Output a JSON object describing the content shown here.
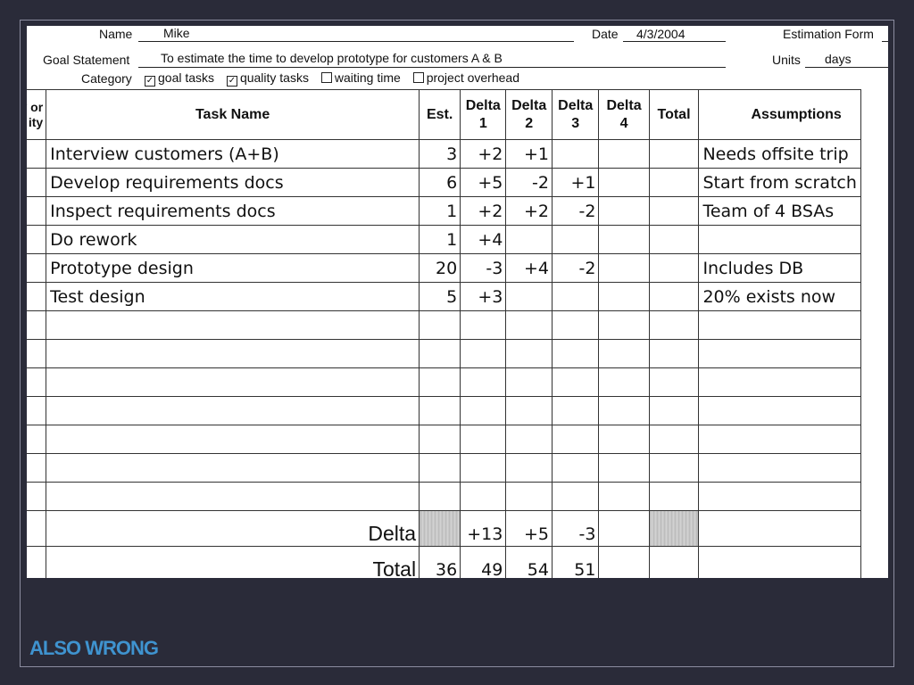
{
  "header": {
    "name_label": "Name",
    "name_value": "Mike",
    "date_label": "Date",
    "date_value": "4/3/2004",
    "form_title": "Estimation Form",
    "goal_label": "Goal Statement",
    "goal_value": "To estimate the time to develop prototype for customers A & B",
    "units_label": "Units",
    "units_value": "days",
    "category_label": "Category",
    "categories": [
      {
        "label": "goal tasks",
        "checked": true
      },
      {
        "label": "quality tasks",
        "checked": true
      },
      {
        "label": "waiting time",
        "checked": false
      },
      {
        "label": "project overhead",
        "checked": false
      }
    ]
  },
  "table": {
    "columns": {
      "cut_line1": "* or",
      "cut_line2": "ity",
      "task_name": "Task Name",
      "est": "Est.",
      "delta1_line1": "Delta",
      "delta1_line2": "1",
      "delta2_line1": "Delta",
      "delta2_line2": "2",
      "delta3_line1": "Delta",
      "delta3_line2": "3",
      "delta4_line1": "Delta",
      "delta4_line2": "4",
      "total": "Total",
      "assumptions": "Assumptions"
    },
    "rows": [
      {
        "task": "Interview customers (A+B)",
        "est": "3",
        "d1": "+2",
        "d2": "+1",
        "d3": "",
        "d4": "",
        "total": "",
        "assumption": "Needs offsite trip"
      },
      {
        "task": "Develop requirements docs",
        "est": "6",
        "d1": "+5",
        "d2": "-2",
        "d3": "+1",
        "d4": "",
        "total": "",
        "assumption": "Start from scratch"
      },
      {
        "task": "Inspect requirements docs",
        "est": "1",
        "d1": "+2",
        "d2": "+2",
        "d3": "-2",
        "d4": "",
        "total": "",
        "assumption": "Team of 4 BSAs"
      },
      {
        "task": "Do rework",
        "est": "1",
        "d1": "+4",
        "d2": "",
        "d3": "",
        "d4": "",
        "total": "",
        "assumption": ""
      },
      {
        "task": "Prototype design",
        "est": "20",
        "d1": "-3",
        "d2": "+4",
        "d3": "-2",
        "d4": "",
        "total": "",
        "assumption": "Includes DB"
      },
      {
        "task": "Test design",
        "est": "5",
        "d1": "+3",
        "d2": "",
        "d3": "",
        "d4": "",
        "total": "",
        "assumption": "20% exists now"
      },
      {
        "task": "",
        "est": "",
        "d1": "",
        "d2": "",
        "d3": "",
        "d4": "",
        "total": "",
        "assumption": ""
      },
      {
        "task": "",
        "est": "",
        "d1": "",
        "d2": "",
        "d3": "",
        "d4": "",
        "total": "",
        "assumption": ""
      },
      {
        "task": "",
        "est": "",
        "d1": "",
        "d2": "",
        "d3": "",
        "d4": "",
        "total": "",
        "assumption": ""
      },
      {
        "task": "",
        "est": "",
        "d1": "",
        "d2": "",
        "d3": "",
        "d4": "",
        "total": "",
        "assumption": ""
      },
      {
        "task": "",
        "est": "",
        "d1": "",
        "d2": "",
        "d3": "",
        "d4": "",
        "total": "",
        "assumption": ""
      },
      {
        "task": "",
        "est": "",
        "d1": "",
        "d2": "",
        "d3": "",
        "d4": "",
        "total": "",
        "assumption": ""
      },
      {
        "task": "",
        "est": "",
        "d1": "",
        "d2": "",
        "d3": "",
        "d4": "",
        "total": "",
        "assumption": ""
      }
    ],
    "delta_row": {
      "label": "Delta",
      "d1": "+13",
      "d2": "+5",
      "d3": "-3",
      "d4": ""
    },
    "total_row": {
      "label": "Total",
      "est": "36",
      "d1": "49",
      "d2": "54",
      "d3": "51",
      "d4": "",
      "total": ""
    }
  },
  "caption": "ALSO WRONG"
}
